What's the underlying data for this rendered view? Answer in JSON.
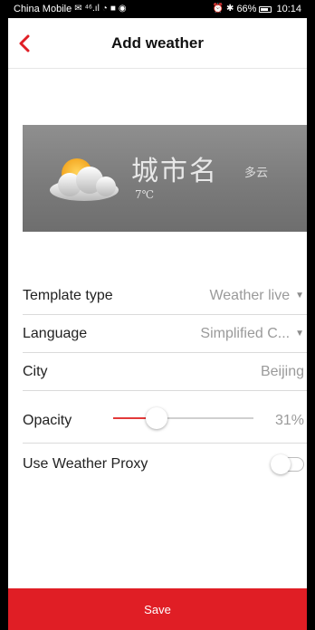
{
  "status_bar": {
    "carrier": "China Mobile",
    "signal_text": "⁴⁶.ıl",
    "battery_percent": "66%",
    "time": "10:14"
  },
  "header": {
    "title": "Add weather",
    "back_icon": "chevron-left-icon"
  },
  "preview": {
    "city_name": "城市名",
    "condition": "多云",
    "temperature": "7℃",
    "weather_icon": "partly-cloudy-icon"
  },
  "settings": {
    "template_type": {
      "label": "Template type",
      "value": "Weather live"
    },
    "language": {
      "label": "Language",
      "value": "Simplified C..."
    },
    "city": {
      "label": "City",
      "value": "Beijing"
    },
    "opacity": {
      "label": "Opacity",
      "value": "31%",
      "level": 0.31
    },
    "weather_proxy": {
      "label": "Use Weather Proxy",
      "enabled": false
    }
  },
  "save_button": {
    "label": "Save"
  },
  "colors": {
    "accent": "#e01e25",
    "slider_fill": "#e33a3a",
    "value_text": "#9a9a9a"
  }
}
